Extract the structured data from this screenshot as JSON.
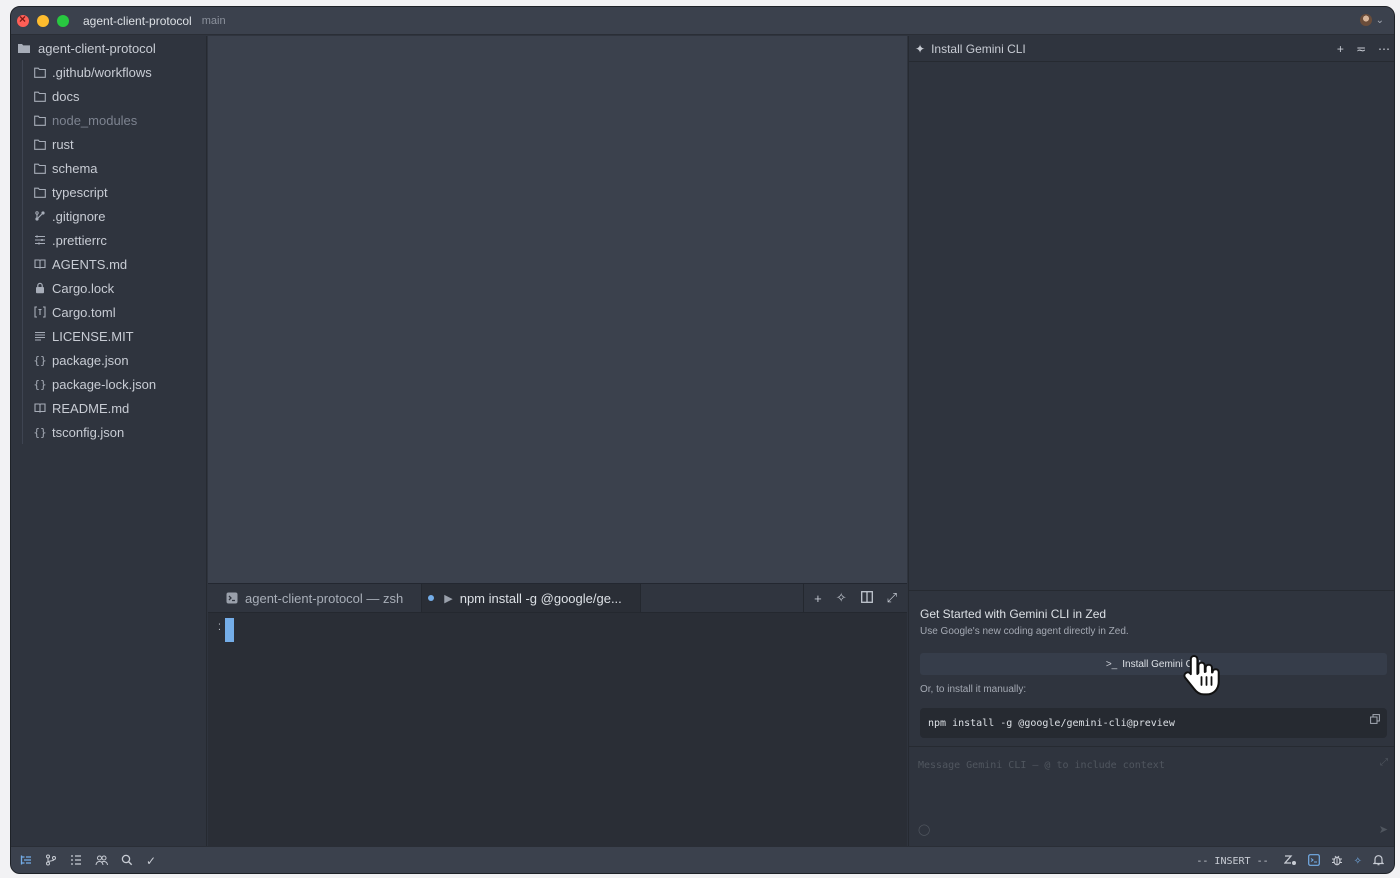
{
  "titlebar": {
    "project": "agent-client-protocol",
    "branch": "main"
  },
  "sidebar": {
    "root": "agent-client-protocol",
    "items": [
      {
        "label": ".github/workflows",
        "icon": "folder-icon",
        "dim": false
      },
      {
        "label": "docs",
        "icon": "folder-icon",
        "dim": false
      },
      {
        "label": "node_modules",
        "icon": "folder-icon",
        "dim": true
      },
      {
        "label": "rust",
        "icon": "folder-icon",
        "dim": false
      },
      {
        "label": "schema",
        "icon": "folder-icon",
        "dim": false
      },
      {
        "label": "typescript",
        "icon": "folder-icon",
        "dim": false
      },
      {
        "label": ".gitignore",
        "icon": "git-icon",
        "dim": false
      },
      {
        "label": ".prettierrc",
        "icon": "settings-lines-icon",
        "dim": false
      },
      {
        "label": "AGENTS.md",
        "icon": "book-icon",
        "dim": false
      },
      {
        "label": "Cargo.lock",
        "icon": "lock-icon",
        "dim": false
      },
      {
        "label": "Cargo.toml",
        "icon": "toml-icon",
        "dim": false
      },
      {
        "label": "LICENSE.MIT",
        "icon": "text-lines-icon",
        "dim": false
      },
      {
        "label": "package.json",
        "icon": "braces-icon",
        "dim": false
      },
      {
        "label": "package-lock.json",
        "icon": "braces-icon",
        "dim": false
      },
      {
        "label": "README.md",
        "icon": "book-icon",
        "dim": false
      },
      {
        "label": "tsconfig.json",
        "icon": "braces-icon",
        "dim": false
      }
    ]
  },
  "terminal": {
    "tabs": [
      {
        "label": "agent-client-protocol — zsh",
        "active": false
      },
      {
        "label": "npm install -g @google/ge...",
        "active": true
      }
    ]
  },
  "agent": {
    "header_title": "Install Gemini CLI",
    "card_title": "Get Started with Gemini CLI in Zed",
    "card_subtitle": "Use Google's new coding agent directly in Zed.",
    "install_button": "Install Gemini CLI",
    "manual_label": "Or, to install it manually:",
    "command": "npm install -g @google/gemini-cli@preview",
    "message_placeholder": "Message Gemini CLI — @ to include context"
  },
  "statusbar": {
    "mode": "-- INSERT --"
  },
  "colors": {
    "accent": "#74ade8",
    "window_bg": "#2f343e",
    "editor_bg": "#3b414d",
    "terminal_bg": "#2a2e36"
  }
}
